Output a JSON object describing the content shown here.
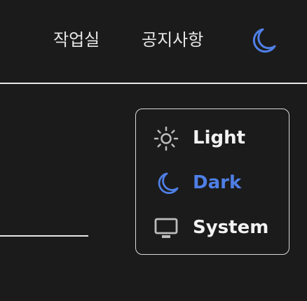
{
  "header": {
    "links": [
      {
        "label": "작업실"
      },
      {
        "label": "공지사항"
      }
    ],
    "theme_toggle_icon": "moon-icon",
    "accent_color": "#4f7fe6"
  },
  "theme_menu": {
    "selected": "Dark",
    "items": [
      {
        "label": "Light",
        "icon": "sun-icon",
        "color": "#f2f2f2"
      },
      {
        "label": "Dark",
        "icon": "moon-icon",
        "color": "#4f7fe6"
      },
      {
        "label": "System",
        "icon": "monitor-icon",
        "color": "#f2f2f2"
      }
    ]
  }
}
